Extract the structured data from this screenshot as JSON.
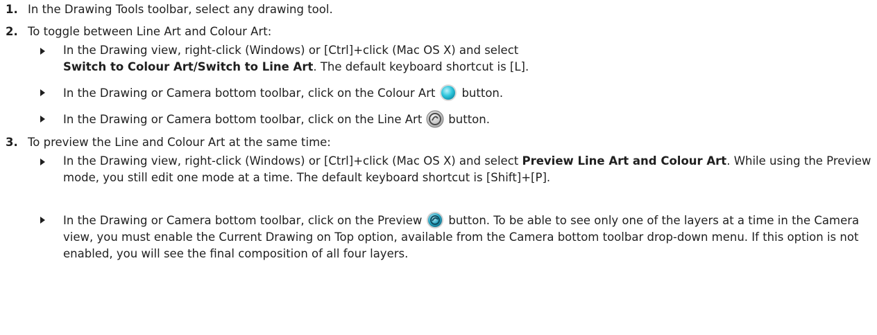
{
  "steps": [
    {
      "number": "1.",
      "text": "In the Drawing Tools toolbar, select any drawing tool."
    },
    {
      "number": "2.",
      "text": "To toggle between Line Art and Colour Art:",
      "bullets": [
        {
          "line1": "In the Drawing view, right-click (Windows) or [Ctrl]+click (Mac OS X) and select",
          "bold": "Switch to Colour Art/Switch to Line Art",
          "after": ". The default keyboard shortcut is [L]."
        },
        {
          "before": "In the Drawing or Camera bottom toolbar, click on the Colour Art",
          "icon": "colour-art-icon",
          "after": "button."
        },
        {
          "before": "In the Drawing or Camera bottom toolbar, click on the Line Art",
          "icon": "line-art-icon",
          "after": "button."
        }
      ]
    },
    {
      "number": "3.",
      "text": "To preview the Line and Colour Art at the same time:",
      "bullets": [
        {
          "before": "In the Drawing view, right-click (Windows) or [Ctrl]+click (Mac OS X) and select",
          "bold": "Preview Line Art and Colour Art",
          "after": ". While using the Preview mode, you still edit one mode at a time. The default keyboard shortcut is [Shift]+[P]."
        },
        {
          "before": "In the Drawing or Camera bottom toolbar, click on the Preview",
          "icon": "preview-icon",
          "after": "button. To be able to see only one of the layers at a time in the Camera view, you must enable the Current Drawing on Top option, available from the Camera bottom toolbar drop-down menu. If this option is not enabled, you will see the final composition of all four layers."
        }
      ]
    }
  ],
  "icon_colors": {
    "colour_art": "#2ec6dc",
    "line_art": "#8a8a8a",
    "preview": "#2aa7c4"
  }
}
